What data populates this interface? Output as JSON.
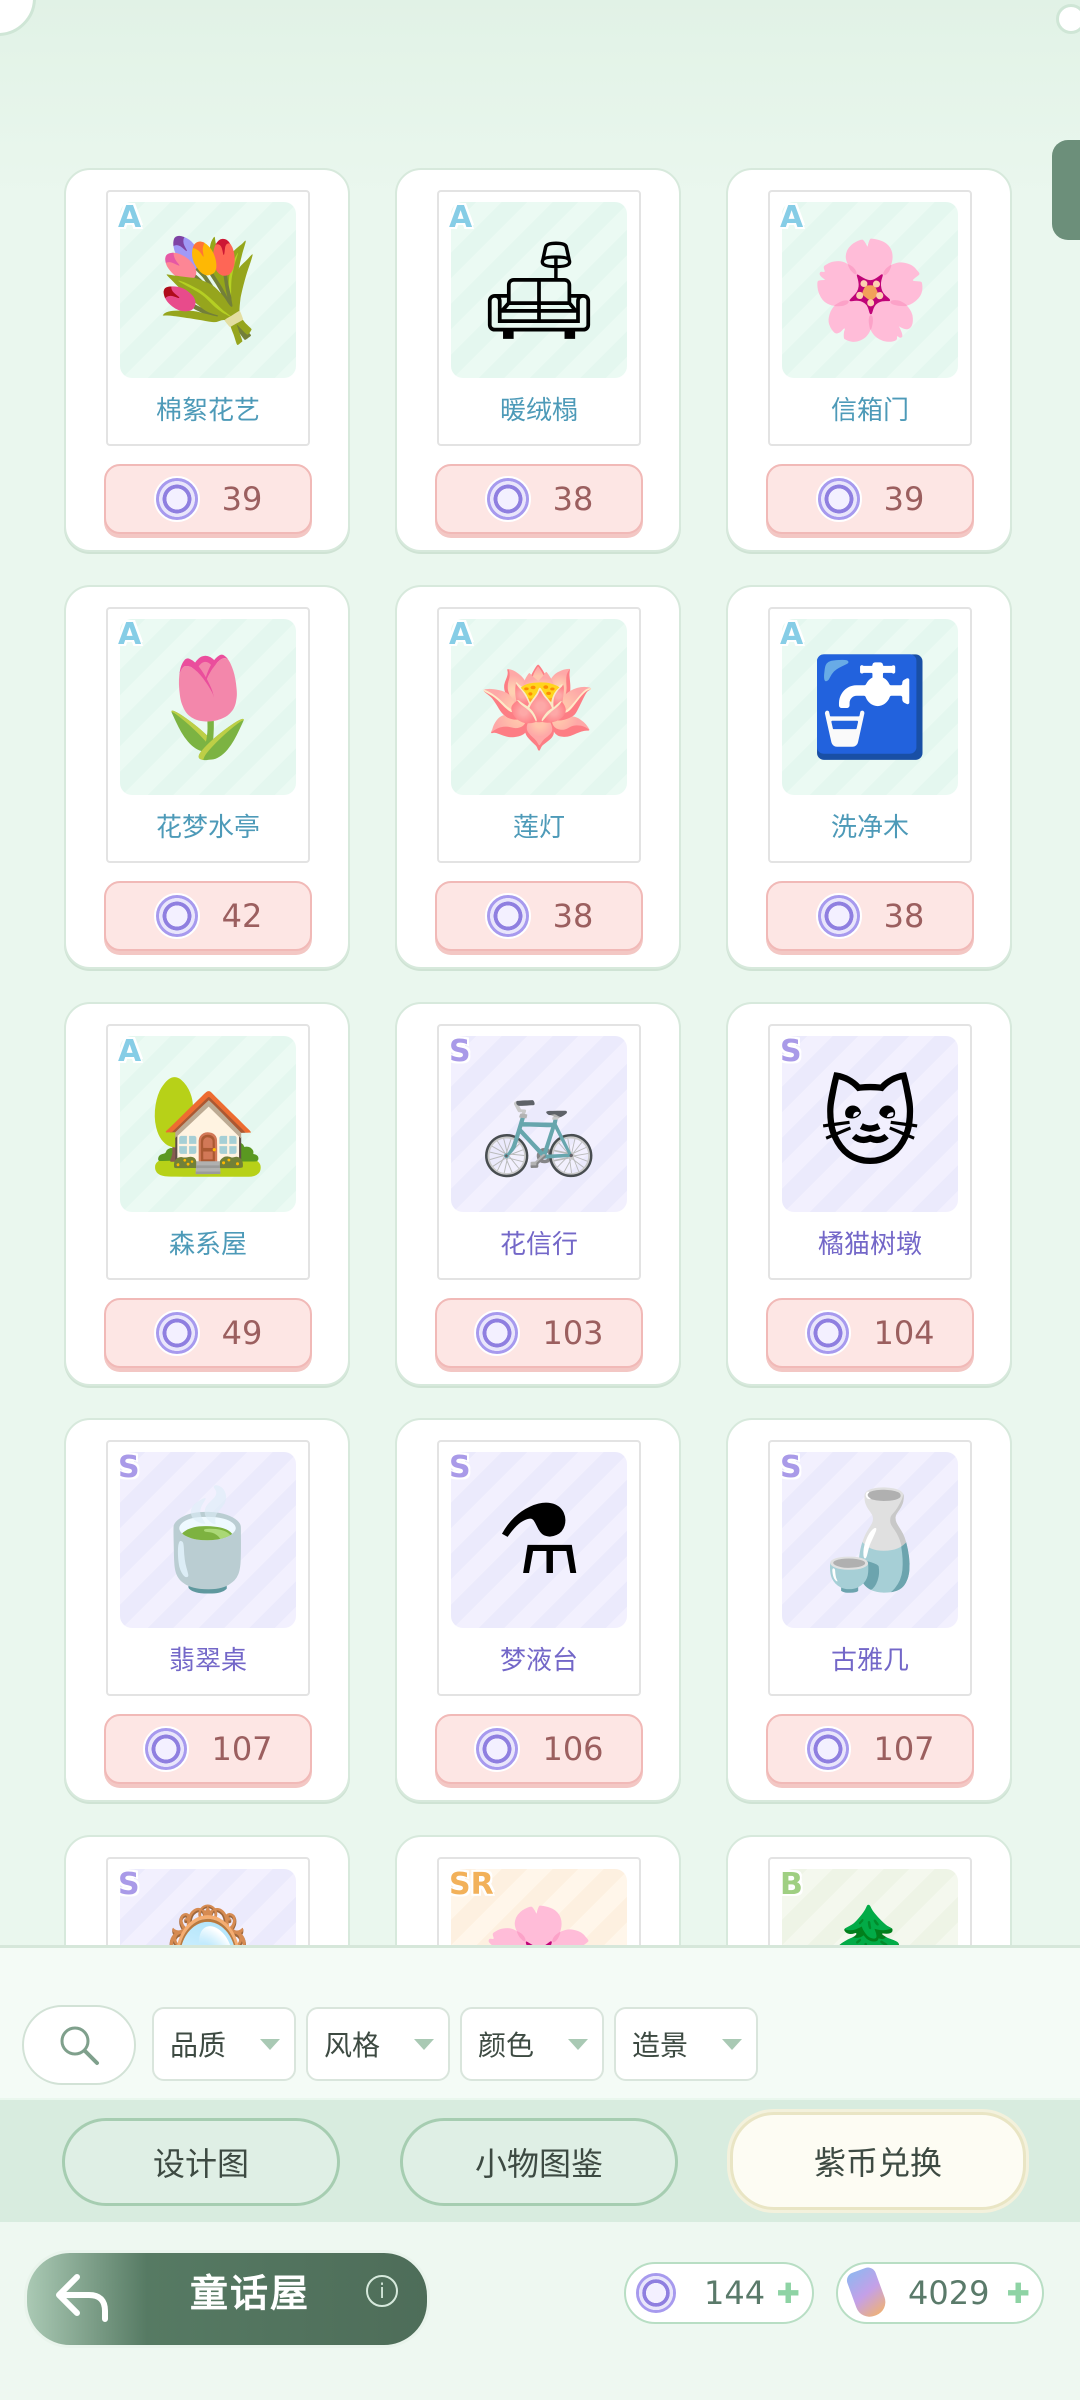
{
  "items": [
    {
      "rarity": "A",
      "name": "棉絮花艺",
      "price": "39",
      "icon": "flower-arrangement-icon",
      "art": "💐"
    },
    {
      "rarity": "A",
      "name": "暖绒榻",
      "price": "38",
      "icon": "sofa-icon",
      "art": "🛋"
    },
    {
      "rarity": "A",
      "name": "信箱门",
      "price": "39",
      "icon": "flower-arch-icon",
      "art": "🌸"
    },
    {
      "rarity": "A",
      "name": "花梦水亭",
      "price": "42",
      "icon": "pavilion-icon",
      "art": "🌷"
    },
    {
      "rarity": "A",
      "name": "莲灯",
      "price": "38",
      "icon": "lotus-lamp-icon",
      "art": "🪷"
    },
    {
      "rarity": "A",
      "name": "洗净木",
      "price": "38",
      "icon": "washstand-icon",
      "art": "🚰"
    },
    {
      "rarity": "A",
      "name": "森系屋",
      "price": "49",
      "icon": "wooden-house-icon",
      "art": "🏡"
    },
    {
      "rarity": "S",
      "name": "花信行",
      "price": "103",
      "icon": "bicycle-icon",
      "art": "🚲"
    },
    {
      "rarity": "S",
      "name": "橘猫树墩",
      "price": "104",
      "icon": "cat-stump-icon",
      "art": "🐱"
    },
    {
      "rarity": "S",
      "name": "翡翠桌",
      "price": "107",
      "icon": "jade-table-icon",
      "art": "🍵"
    },
    {
      "rarity": "S",
      "name": "梦液台",
      "price": "106",
      "icon": "dream-stand-icon",
      "art": "⚗"
    },
    {
      "rarity": "S",
      "name": "古雅几",
      "price": "107",
      "icon": "antique-table-icon",
      "art": "🍶"
    },
    {
      "rarity": "S",
      "name": "",
      "price": "",
      "icon": "mirror-icon",
      "art": "🪞"
    },
    {
      "rarity": "SR",
      "name": "",
      "price": "",
      "icon": "blossom-icon",
      "art": "🌸"
    },
    {
      "rarity": "B",
      "name": "",
      "price": "",
      "icon": "plant-icon",
      "art": "🌲"
    }
  ],
  "filters": {
    "quality": "品质",
    "style": "风格",
    "color": "颜色",
    "shape": "造景"
  },
  "tabs": {
    "blueprint": "设计图",
    "collection": "小物图鉴",
    "exchange": "紫币兑换"
  },
  "footer": {
    "title": "童话屋",
    "info": "i",
    "purple_coins": "144",
    "crystals": "4029"
  },
  "colors": {
    "background": "#eaf7ee",
    "price_bg": "#fde6e4",
    "accent_green": "#567a63"
  }
}
